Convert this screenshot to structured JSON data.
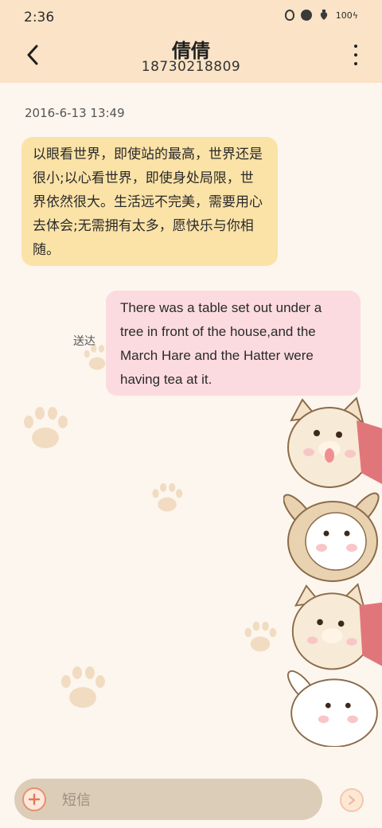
{
  "status_bar": {
    "time": "2:36",
    "battery": "100"
  },
  "header": {
    "contact_name": "倩倩",
    "phone_number": "18730218809"
  },
  "conversation": {
    "timestamp": "2016-6-13 13:49",
    "messages": [
      {
        "direction": "incoming",
        "text": "以眼看世界，即使站的最高，世界还是很小;以心看世界，即使身处局限，世界依然很大。生活远不完美，需要用心去体会;无需拥有太多，愿快乐与你相随。"
      },
      {
        "direction": "outgoing",
        "status": "送达",
        "text": "There was a table set out under a tree in front of the house,and the March Hare and the Hatter were having tea at it."
      }
    ]
  },
  "composer": {
    "placeholder": "短信"
  },
  "icons": {
    "back": "back-arrow-icon",
    "more": "more-vertical-icon",
    "add": "add-icon",
    "send": "send-icon"
  },
  "colors": {
    "header_bg": "#fae3c6",
    "incoming_bubble": "#fbe3a8",
    "outgoing_bubble": "#fbdbe0",
    "chat_bg": "#fdf6ee"
  }
}
